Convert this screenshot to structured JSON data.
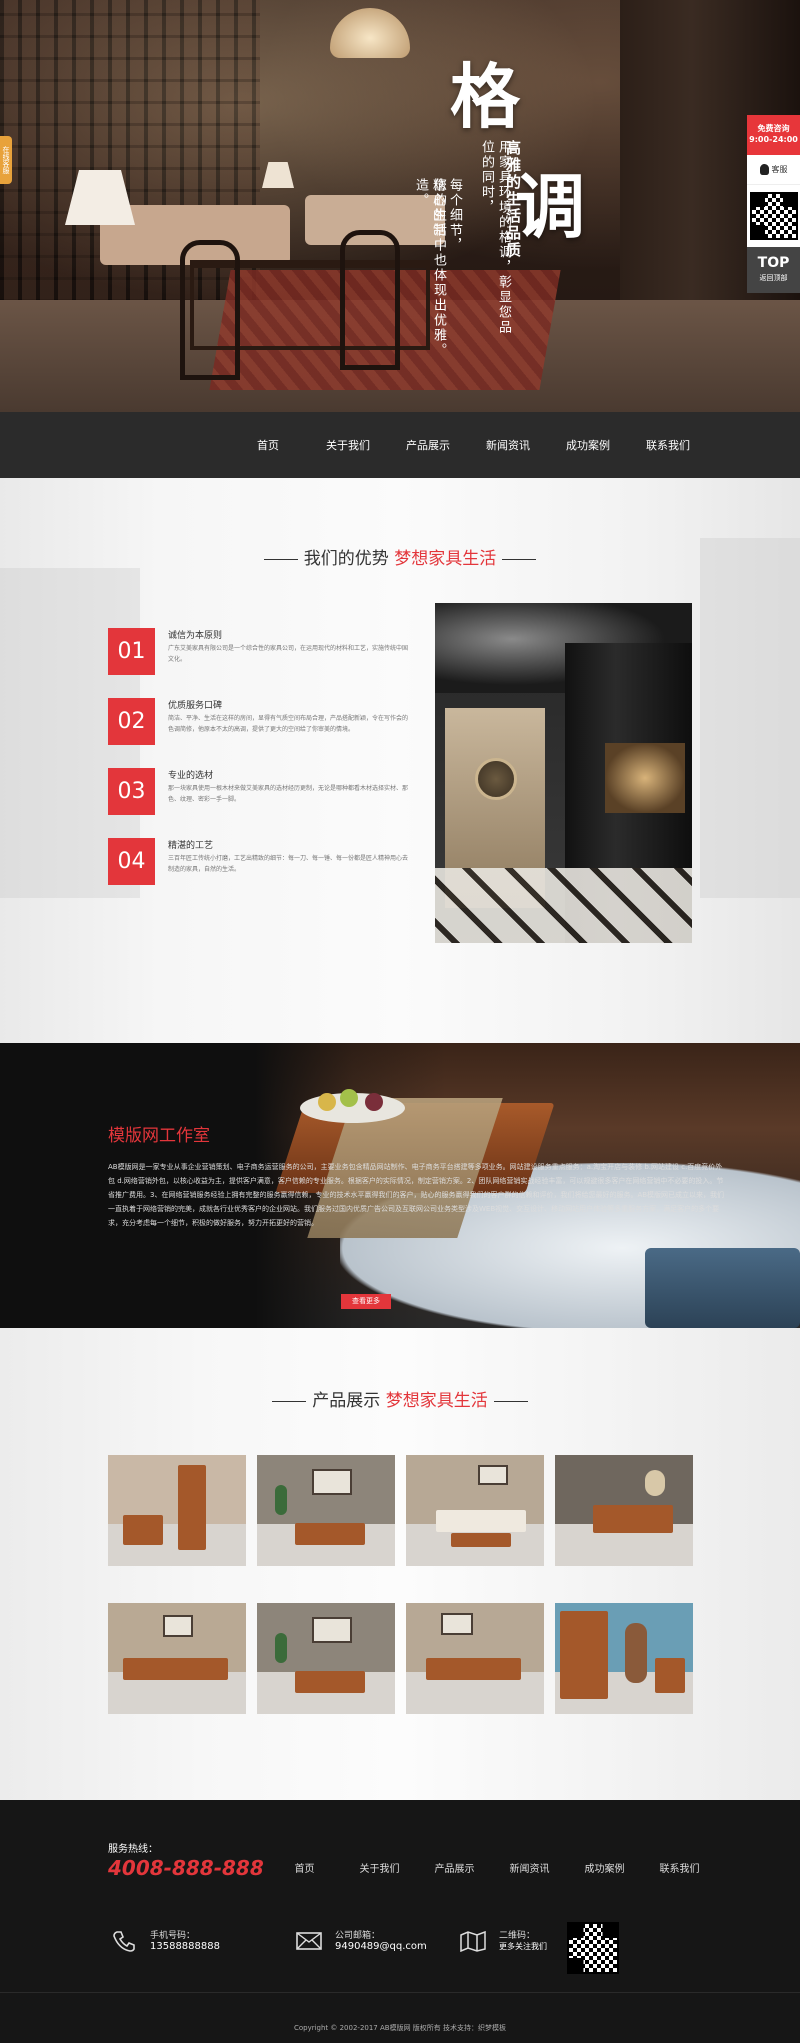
{
  "hero": {
    "title_char_1": "格",
    "title_char_2": "调",
    "subtitle": "高雅的生活品质",
    "line_1": "用家具环境的格调，彰显您品位的同时，",
    "line_2": "您的生活中也体现出优雅。",
    "line_3": "每个细节，精心的制造。",
    "side_tab": "在线客服"
  },
  "float_panel": {
    "consult_title": "免费咨询",
    "consult_hours": "9:00-24:00",
    "qq_label": "客服",
    "top_label": "TOP",
    "top_sub": "返回顶部"
  },
  "nav": {
    "items": [
      "首页",
      "关于我们",
      "产品展示",
      "新闻资讯",
      "成功案例",
      "联系我们"
    ]
  },
  "advantages": {
    "title_plain": "我们的优势",
    "title_red": "梦想家具生活",
    "items": [
      {
        "num": "01",
        "title": "诚信为本原则",
        "desc": "广东艾美家具有限公司是一个综合性的家具公司，在运用现代的材料和工艺，实施传统中国文化。"
      },
      {
        "num": "02",
        "title": "优质服务口碑",
        "desc": "简洁、平净、生活在这样的房间，显得有气质空间布局合理，产品搭配新颖，令在写作会的色调简修，他原本不太的高调，提供了更大的空间给了你审美的情境。"
      },
      {
        "num": "03",
        "title": "专业的选材",
        "desc": "那一块家具使用一根木材来做艾美家具的选材经历更制，无论是哪种都看木材选择实材、那色、纹理、密彩一手一脚。"
      },
      {
        "num": "04",
        "title": "精湛的工艺",
        "desc": "三百年匠工传统小打磨，工艺出精致的细节：每一刀、每一锤、每一份都是匠人精神用心去制造的家具，自然的生活。"
      }
    ]
  },
  "studio": {
    "title": "模版网工作室",
    "body": "AB模版网是一家专业从事企业营销策划、电子商务运营服务的公司，主要业务包含精品网站制作、电子商务平台搭建等多项业务。网站建设服务重点服务：a.淘宝开店与装修 b.网站建设 c.百度竞价外包 d.网络营销外包，以核心收益为主，提供客户满意，客户信赖的专业服务。根据客户的实际情况，制定营销方案。2、团队网络营销实战经验丰富，可以规避很多客户在网络营销中不必要的投入。节省推广费用。3、在网络营销服务经验上拥有完整的服务赢得信赖，专业的技术水平赢得我们的客户，贴心的服务赢得我们的客户群的信赖和评价，我们将给您最好的服务。AB模版网已成立以来，我们一直执着于网络营销的完美，成就各行业优秀客户的企业网站。我们服务过国内优质广告公司及互联网公司业务类型涉及WEB视觉、交互设计、移动网站用户体验等多重服务方案，满足客户的多个要求，充分考虑每一个细节，积极的做好服务，努力开拓更好的营销。",
    "more": "查看更多"
  },
  "products": {
    "title_plain": "产品展示",
    "title_red": "梦想家具生活"
  },
  "footer": {
    "hotline_label": "服务热线：",
    "hotline": "4008-888-888",
    "nav": [
      "首页",
      "关于我们",
      "产品展示",
      "新闻资讯",
      "成功案例",
      "联系我们"
    ],
    "phone_label": "手机号码：",
    "phone": "13588888888",
    "email_label": "公司邮箱：",
    "email": "9490489@qq.com",
    "qr_label": "二维码：",
    "qr_sub": "更多关注我们",
    "copyright": "Copyright © 2002-2017 AB模版网 版权所有 技术支持：织梦模板"
  }
}
